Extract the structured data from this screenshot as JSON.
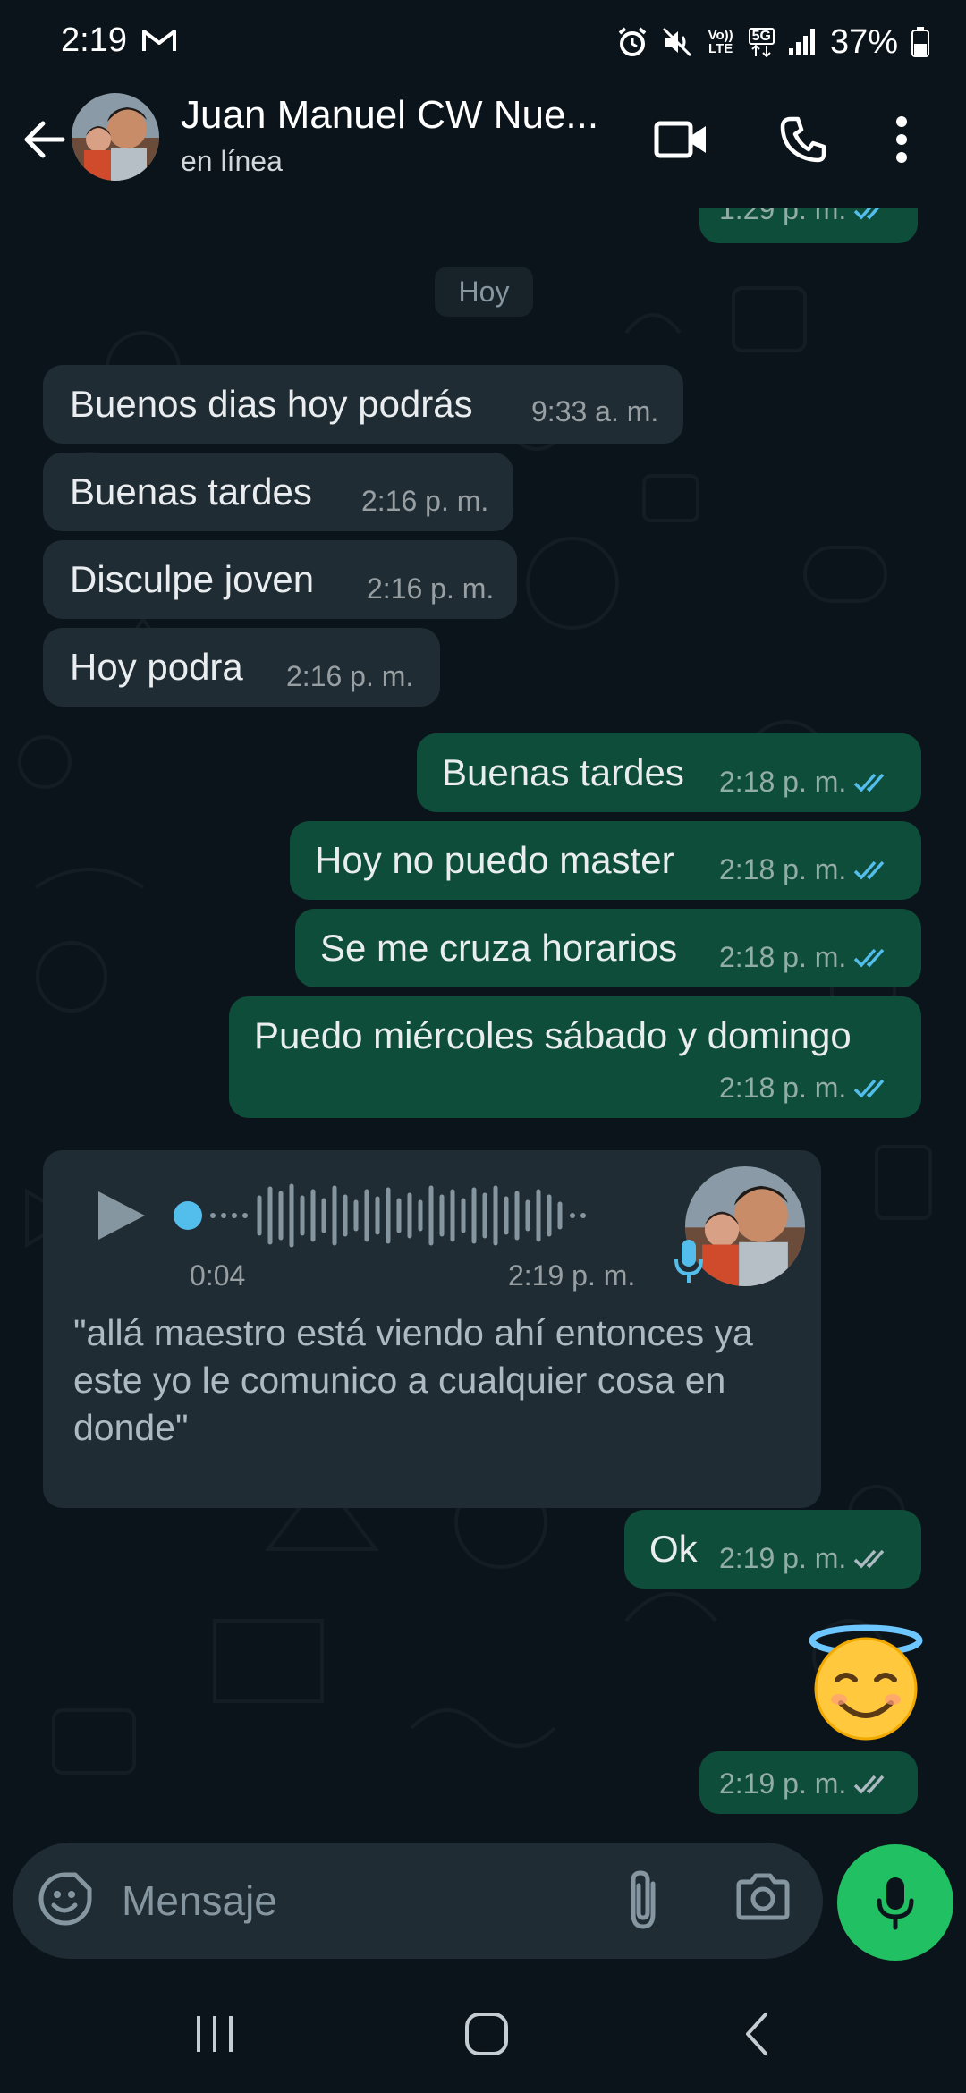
{
  "status_bar": {
    "time": "2:19",
    "network": "5G",
    "volte": "Vo)) LTE",
    "battery": "37%"
  },
  "header": {
    "contact_name": "Juan Manuel CW Nue...",
    "status": "en línea"
  },
  "chat": {
    "date_separator": "Hoy",
    "top_partial_time": "1:29 p. m.",
    "messages": [
      {
        "dir": "in",
        "text": "Buenos dias hoy podrás",
        "time": "9:33 a. m."
      },
      {
        "dir": "in",
        "text": "Buenas tardes",
        "time": "2:16 p. m."
      },
      {
        "dir": "in",
        "text": "Disculpe joven",
        "time": "2:16 p. m."
      },
      {
        "dir": "in",
        "text": "Hoy podra",
        "time": "2:16 p. m."
      },
      {
        "dir": "out",
        "text": "Buenas tardes",
        "time": "2:18 p. m.",
        "status": "read"
      },
      {
        "dir": "out",
        "text": "Hoy no puedo master",
        "time": "2:18 p. m.",
        "status": "read"
      },
      {
        "dir": "out",
        "text": "Se me cruza horarios",
        "time": "2:18 p. m.",
        "status": "read"
      },
      {
        "dir": "out",
        "text": "Puedo miércoles sábado y domingo",
        "time": "2:18 p. m.",
        "status": "read"
      },
      {
        "dir": "out",
        "text": "Ok",
        "time": "2:19 p. m.",
        "status": "delivered"
      },
      {
        "dir": "out",
        "text": "",
        "emoji": "smiling-face-with-halo",
        "time": "2:19 p. m.",
        "status": "delivered"
      }
    ],
    "voice_note": {
      "duration": "0:04",
      "time": "2:19 p. m.",
      "progress": 0.0,
      "transcript": "\"allá maestro está viendo ahí entonces ya este yo le comunico a cualquier cosa en donde\""
    }
  },
  "input": {
    "placeholder": "Mensaje"
  },
  "colors": {
    "background": "#0b141a",
    "incoming_bubble": "#202c33",
    "outgoing_bubble": "#0f4d3b",
    "accent_green": "#21c063",
    "read_ticks": "#53bdeb"
  },
  "icons": [
    "back-arrow-icon",
    "video-call-icon",
    "phone-icon",
    "more-vert-icon",
    "play-icon",
    "mic-icon",
    "emoji-icon",
    "attach-icon",
    "camera-icon",
    "nav-recents-icon",
    "nav-home-icon",
    "nav-back-icon"
  ]
}
